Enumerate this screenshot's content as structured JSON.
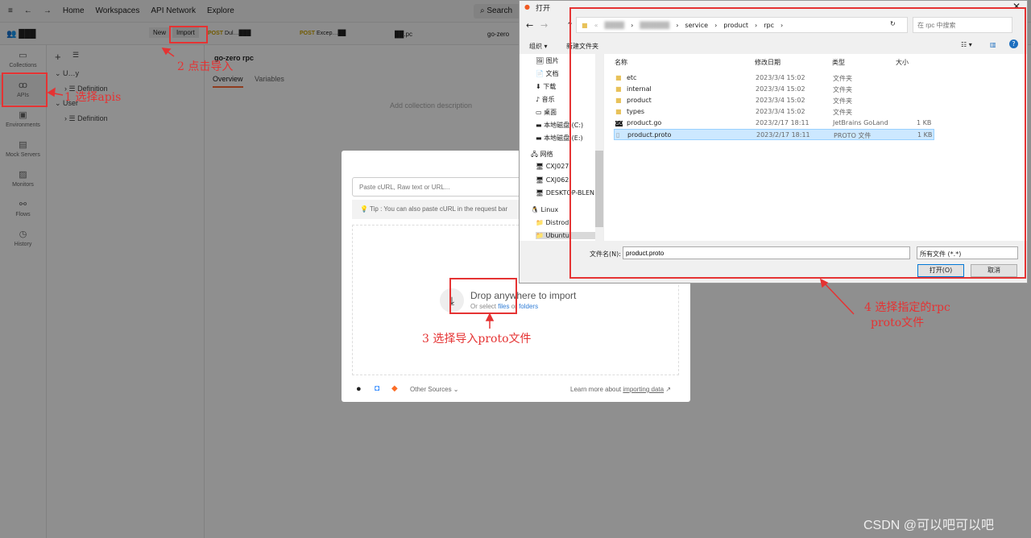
{
  "topbar": {
    "nav": [
      "Home",
      "Workspaces",
      "API Network",
      "Explore"
    ],
    "search": "Search"
  },
  "secbar": {
    "workspace": "███",
    "new": "New",
    "import": "Import",
    "tabs": [
      {
        "method": "POST",
        "name": "Dul…███"
      },
      {
        "method": "POST",
        "name": "Excep…██"
      },
      {
        "method": "",
        "name": "██.pc"
      },
      {
        "method": "",
        "name": "go-zero"
      }
    ]
  },
  "sidebar": [
    {
      "label": "Collections",
      "icon": "collections-icon"
    },
    {
      "label": "APIs",
      "icon": "apis-icon"
    },
    {
      "label": "Environments",
      "icon": "environments-icon"
    },
    {
      "label": "Mock Servers",
      "icon": "mock-servers-icon"
    },
    {
      "label": "Monitors",
      "icon": "monitors-icon"
    },
    {
      "label": "Flows",
      "icon": "flows-icon"
    },
    {
      "label": "History",
      "icon": "history-icon"
    }
  ],
  "tree": [
    {
      "label": "U…y",
      "child": "Definition"
    },
    {
      "label": "User",
      "child": "Definition"
    }
  ],
  "main": {
    "title": "go-zero rpc",
    "tabs": [
      "Overview",
      "Variables"
    ],
    "description": "Add collection description"
  },
  "modal": {
    "placeholder": "Paste cURL, Raw text or URL...",
    "tip": "Tip : You can also paste cURL in the request bar",
    "drop_title": "Drop anywhere to import",
    "drop_sub": "Or select",
    "files": "files",
    "or": "or",
    "folders": "folders",
    "other_sources": "Other Sources",
    "learn": "Learn more about",
    "learn_link": "importing data"
  },
  "dialog": {
    "title": "打开",
    "path": [
      "«",
      "████",
      "██████",
      "service",
      "product",
      "rpc"
    ],
    "search_placeholder": "在 rpc 中搜索",
    "organize": "组织 ▾",
    "new_folder": "新建文件夹",
    "nav": [
      "图片",
      "文档",
      "下载",
      "音乐",
      "桌面",
      "本地磁盘 (C:)",
      "本地磁盘 (E:)",
      "网络",
      "CXJ027",
      "CXJ062",
      "DESKTOP-BLEN",
      "Linux",
      "Distrod",
      "Ubuntu"
    ],
    "columns": [
      "名称",
      "修改日期",
      "类型",
      "大小"
    ],
    "files": [
      {
        "name": "etc",
        "date": "2023/3/4 15:02",
        "type": "文件夹",
        "size": ""
      },
      {
        "name": "internal",
        "date": "2023/3/4 15:02",
        "type": "文件夹",
        "size": ""
      },
      {
        "name": "product",
        "date": "2023/3/4 15:02",
        "type": "文件夹",
        "size": ""
      },
      {
        "name": "types",
        "date": "2023/3/4 15:02",
        "type": "文件夹",
        "size": ""
      },
      {
        "name": "product.go",
        "date": "2023/2/17 18:11",
        "type": "JetBrains GoLand",
        "size": "1 KB"
      },
      {
        "name": "product.proto",
        "date": "2023/2/17 18:11",
        "type": "PROTO 文件",
        "size": "1 KB"
      }
    ],
    "filename_label": "文件名(N):",
    "filename": "product.proto",
    "filter": "所有文件 (*.*)",
    "open": "打开(O)",
    "cancel": "取消"
  },
  "annotations": [
    "1 选择apis",
    "2 点击导入",
    "3 选择导入proto文件",
    "4 选择指定的rpc",
    "proto文件"
  ],
  "watermark": "CSDN @可以吧可以吧",
  "colors": {
    "annotation": "#e53333",
    "accent": "#ff6c37",
    "selected": "#cce8ff"
  }
}
